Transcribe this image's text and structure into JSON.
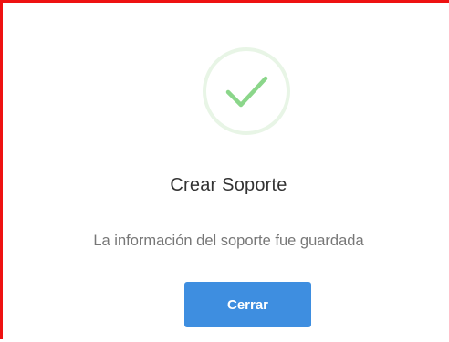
{
  "dialog": {
    "icon": "success-check-icon",
    "title": "Crear Soporte",
    "message": "La información del soporte fue guardada",
    "close_label": "Cerrar"
  },
  "colors": {
    "frame_border": "#ee1111",
    "check": "#8bd68a",
    "circle": "#e8f5e6",
    "button": "#3e8ee0"
  }
}
